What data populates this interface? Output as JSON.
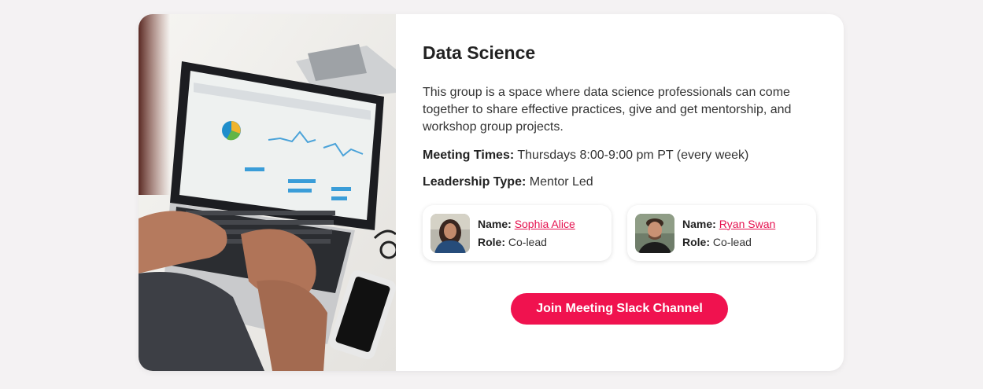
{
  "group": {
    "title": "Data Science",
    "description": "This group is a space where data science professionals can come together to share effective practices, give and get mentorship, and workshop group projects.",
    "meeting_label": "Meeting Times:",
    "meeting_value": "Thursdays 8:00-9:00 pm PT (every week)",
    "leadership_label": "Leadership Type:",
    "leadership_value": "Mentor Led"
  },
  "leaders": [
    {
      "name_label": "Name:",
      "name": "Sophia Alice",
      "role_label": "Role:",
      "role": "Co-lead"
    },
    {
      "name_label": "Name:",
      "name": "Ryan Swan",
      "role_label": "Role:",
      "role": "Co-lead"
    }
  ],
  "join_button": "Join Meeting Slack Channel",
  "colors": {
    "accent": "#f0124f",
    "link": "#e5114f",
    "background": "#f4f2f3"
  }
}
